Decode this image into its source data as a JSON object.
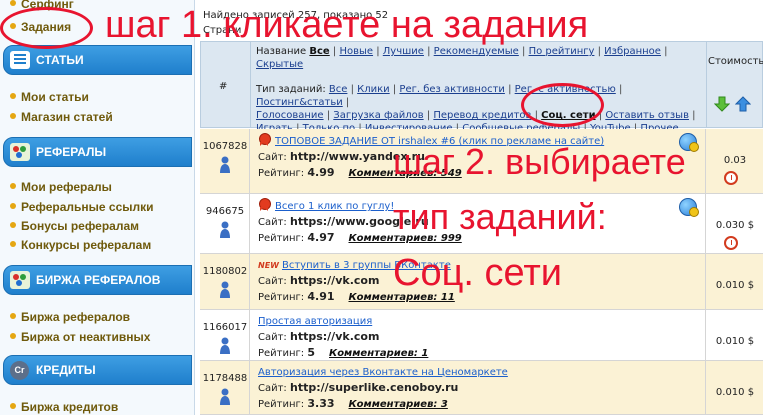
{
  "sidebar": {
    "links_top": [
      {
        "label": "Серфинг"
      },
      {
        "label": "Задания"
      }
    ],
    "sections": [
      {
        "header": "СТАТЬИ",
        "icon": "document-icon",
        "items": [
          "Мои статьи",
          "Магазин статей"
        ]
      },
      {
        "header": "РЕФЕРАЛЫ",
        "icon": "people-icon",
        "items": [
          "Мои рефералы",
          "Реферальные ссылки",
          "Бонусы рефералам",
          "Конкурсы рефералам"
        ]
      },
      {
        "header": "БИРЖА РЕФЕРАЛОВ",
        "icon": "people-icon",
        "items": [
          "Биржа рефералов",
          "Биржа от неактивных"
        ]
      },
      {
        "header": "КРЕДИТЫ",
        "icon": "credits-icon",
        "items": [
          "Биржа кредитов"
        ]
      }
    ],
    "credits_icon_text": "Cr"
  },
  "info": {
    "found": "Найдено записей 257, показано 52",
    "pages": "Страни"
  },
  "table": {
    "hash": "#",
    "cost": "Стоимость",
    "name_label": "Название",
    "name_filters": [
      {
        "label": "Все",
        "active": true
      },
      {
        "label": "Новые"
      },
      {
        "label": "Лучшие"
      },
      {
        "label": "Рекомендуемые"
      },
      {
        "label": "По рейтингу"
      },
      {
        "label": "Избранное"
      },
      {
        "label": "Скрытые"
      }
    ],
    "type_label": "Тип заданий:",
    "type_filters": [
      {
        "label": "Все"
      },
      {
        "label": "Клики"
      },
      {
        "label": "Рег. без активности"
      },
      {
        "label": "Рег. с активностью"
      },
      {
        "label": "Постинг&статьи"
      },
      {
        "label": "Голосование"
      },
      {
        "label": "Загрузка файлов"
      },
      {
        "label": "Перевод кредитов"
      },
      {
        "label": "Соц. сети",
        "active": true
      },
      {
        "label": "Оставить отзыв"
      },
      {
        "label": "Играть"
      },
      {
        "label": "Только по"
      },
      {
        "label": "Инвестирование"
      },
      {
        "label": "Сообщевые рефералы"
      },
      {
        "label": "YouTube"
      },
      {
        "label": "Прочее"
      }
    ]
  },
  "rows": [
    {
      "id": "1067828",
      "title": "ТОПОВОЕ ЗАДАНИЕ ОТ irshalex #6 (клик по рекламе на сайте)",
      "site_label": "Сайт:",
      "site": "http://www.yandex.ru",
      "rating_label": "Рейтинг:",
      "rating": "4.99",
      "comments": "Комментариев: 549",
      "price": "0.03",
      "badge": "ribbon",
      "highlight": true
    },
    {
      "id": "946675",
      "title": "Всего 1 клик по гуглу!",
      "site_label": "Сайт:",
      "site": "https://www.google.ru",
      "rating_label": "Рейтинг:",
      "rating": "4.97",
      "comments": "Комментариев: 999",
      "price": "0.030 $",
      "badge": "ribbon",
      "highlight": false
    },
    {
      "id": "1180802",
      "title": "Вступить в 3 группы ВКонтакте",
      "site_label": "Сайт:",
      "site": "https://vk.com",
      "rating_label": "Рейтинг:",
      "rating": "4.91",
      "comments": "Комментариев: 11",
      "price": "0.010 $",
      "badge": "new",
      "highlight": true
    },
    {
      "id": "1166017",
      "title": "Простая авторизация",
      "site_label": "Сайт:",
      "site": "https://vk.com",
      "rating_label": "Рейтинг:",
      "rating": "5",
      "comments": "Комментариев: 1",
      "price": "0.010 $",
      "badge": "",
      "highlight": false
    },
    {
      "id": "1178488",
      "title": "Авторизация через Вконтакте на Ценомаркете",
      "site_label": "Сайт:",
      "site": "http://superlike.cenoboy.ru",
      "rating_label": "Рейтинг:",
      "rating": "3.33",
      "comments": "Комментариев: 3",
      "price": "0.010 $",
      "badge": "",
      "highlight": true
    }
  ],
  "badges": {
    "new": "NEW"
  },
  "annotations": {
    "step1": "шаг 1. кликаете на задания",
    "step2_line1": "шаг 2. выбираете",
    "step2_line2": "тип заданий:",
    "step2_line3": "Соц. сети"
  },
  "colors": {
    "annotation": "#e8142f",
    "sidebar_header": "#1f7fcc",
    "link": "#1b5fcc",
    "row_highlight": "#fbf2d5"
  }
}
